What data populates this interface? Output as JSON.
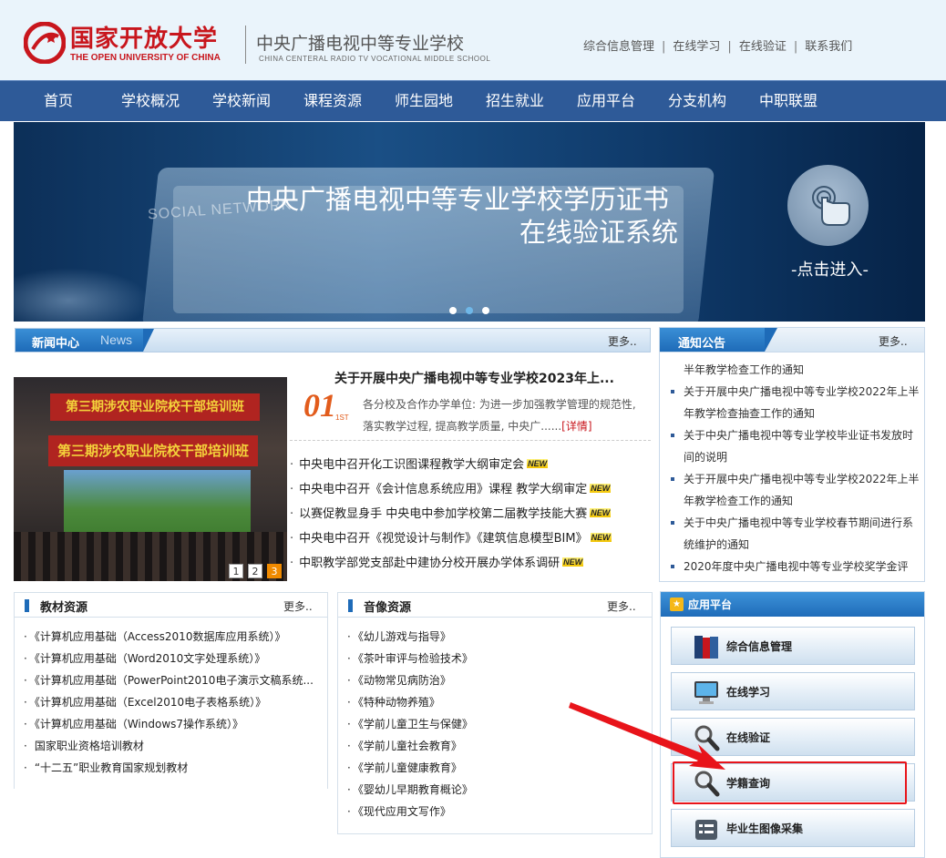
{
  "header": {
    "logo_cn": "国家开放大学",
    "logo_en": "THE OPEN UNIVERSITY OF CHINA",
    "school_cn": "中央广播电视中等专业学校",
    "school_en": "CHINA CENTERAL RADIO TV VOCATIONAL MIDDLE SCHOOL",
    "links": [
      "综合信息管理",
      "在线学习",
      "在线验证",
      "联系我们"
    ]
  },
  "nav": {
    "items": [
      "首页",
      "学校概况",
      "学校新闻",
      "课程资源",
      "师生园地",
      "招生就业",
      "应用平台",
      "分支机构",
      "中职联盟"
    ]
  },
  "banner": {
    "social_text": "SOCIAL NETWORK",
    "title_line1": "中央广播电视中等专业学校学历证书",
    "title_line2": "在线验证系统",
    "enter_text": "-点击进入-"
  },
  "news": {
    "title": "新闻中心",
    "title_en": "News",
    "more": "更多..",
    "photo_banner1": "第三期涉农职业院校干部培训班",
    "photo_banner2": "第三期涉农职业院校干部培训班",
    "photo_pages": [
      "1",
      "2",
      "3"
    ],
    "feature_number": "01",
    "feature_suffix": "1ST",
    "feature_title": "关于开展中央广播电视中等专业学校2023年上...",
    "feature_text": "各分校及合作办学单位: 为进一步加强教学管理的规范性, 落实教学过程, 提高教学质量, 中央广......",
    "feature_detail": "[详情]",
    "new_badge": "NEW",
    "items": [
      "中央电中召开化工识图课程教学大纲审定会",
      "中央电中召开《会计信息系统应用》课程 教学大纲审定",
      "以赛促教显身手 中央电中参加学校第二届教学技能大赛",
      "中央电中召开《视觉设计与制作》《建筑信息模型BIM》",
      "中职教学部党支部赴中建协分校开展办学体系调研"
    ]
  },
  "notice": {
    "title": "通知公告",
    "more": "更多..",
    "items": [
      {
        "text": "半年教学检查工作的通知",
        "bullet": false
      },
      {
        "text": "关于开展中央广播电视中等专业学校2022年上半年教学检查抽查工作的通知",
        "bullet": true
      },
      {
        "text": "关于中央广播电视中等专业学校毕业证书发放时间的说明",
        "bullet": true
      },
      {
        "text": "关于开展中央广播电视中等专业学校2022年上半年教学检查工作的通知",
        "bullet": true
      },
      {
        "text": "关于中央广播电视中等专业学校春节期间进行系统维护的通知",
        "bullet": true
      },
      {
        "text": "2020年度中央广播电视中等专业学校奖学金评",
        "bullet": true
      }
    ]
  },
  "textbooks": {
    "title": "教材资源",
    "more": "更多..",
    "items": [
      "《计算机应用基础（Access2010数据库应用系统）》",
      "《计算机应用基础（Word2010文字处理系统）》",
      "《计算机应用基础（PowerPoint2010电子演示文稿系统...",
      "《计算机应用基础（Excel2010电子表格系统）》",
      "《计算机应用基础（Windows7操作系统）》",
      "国家职业资格培训教材",
      "“十二五”职业教育国家规划教材"
    ]
  },
  "media": {
    "title": "音像资源",
    "more": "更多..",
    "items": [
      "《幼儿游戏与指导》",
      "《茶叶审评与检验技术》",
      "《动物常见病防治》",
      "《特种动物养殖》",
      "《学前儿童卫生与保健》",
      "《学前儿童社会教育》",
      "《学前儿童健康教育》",
      "《婴幼儿早期教育概论》",
      "《现代应用文写作》"
    ]
  },
  "app_platform": {
    "title": "应用平台",
    "buttons": [
      {
        "label": "综合信息管理",
        "icon": "books-icon"
      },
      {
        "label": "在线学习",
        "icon": "monitor-icon"
      },
      {
        "label": "在线验证",
        "icon": "magnifier-icon"
      },
      {
        "label": "学籍查询",
        "icon": "magnifier-icon"
      },
      {
        "label": "毕业生图像采集",
        "icon": "form-icon"
      }
    ]
  },
  "colors": {
    "brand_red": "#c8161d",
    "nav_blue": "#2e5a98",
    "annotation_red": "#e8141a"
  }
}
